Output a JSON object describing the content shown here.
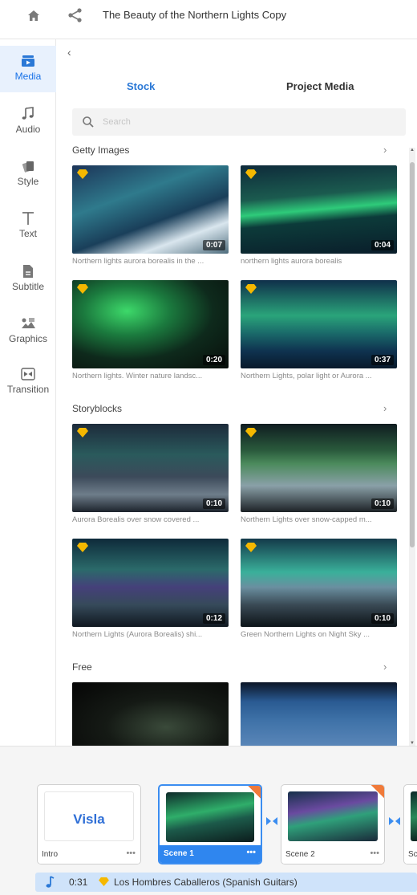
{
  "header": {
    "title": "The Beauty of the Northern Lights Copy"
  },
  "sidebar": {
    "items": [
      {
        "label": "Media",
        "icon": "media-icon",
        "active": true
      },
      {
        "label": "Audio",
        "icon": "music-note-icon"
      },
      {
        "label": "Style",
        "icon": "style-icon"
      },
      {
        "label": "Text",
        "icon": "text-icon"
      },
      {
        "label": "Subtitle",
        "icon": "subtitle-icon"
      },
      {
        "label": "Graphics",
        "icon": "graphics-icon"
      },
      {
        "label": "Transition",
        "icon": "transition-icon"
      }
    ]
  },
  "panel": {
    "tabs": {
      "stock": "Stock",
      "project": "Project Media"
    },
    "search": {
      "placeholder": "Search",
      "value": ""
    },
    "sections": {
      "getty": {
        "title": "Getty Images",
        "items": [
          {
            "duration": "0:07",
            "caption": "Northern lights aurora borealis in the ..."
          },
          {
            "duration": "0:04",
            "caption": "northern lights aurora borealis"
          },
          {
            "duration": "0:20",
            "caption": "Northern lights. Winter nature landsc..."
          },
          {
            "duration": "0:37",
            "caption": "Northern Lights, polar light or Aurora ..."
          }
        ]
      },
      "storyblocks": {
        "title": "Storyblocks",
        "items": [
          {
            "duration": "0:10",
            "caption": "Aurora Borealis over snow covered ..."
          },
          {
            "duration": "0:10",
            "caption": "Northern Lights over snow-capped m..."
          },
          {
            "duration": "0:12",
            "caption": "Northern Lights (Aurora Borealis) shi..."
          },
          {
            "duration": "0:10",
            "caption": "Green Northern Lights on Night Sky ..."
          }
        ]
      },
      "free": {
        "title": "Free"
      }
    }
  },
  "timeline": {
    "scenes": [
      {
        "name": "Intro",
        "logo": "Visla",
        "more": "•••"
      },
      {
        "name": "Scene 1",
        "more": "•••",
        "active": true
      },
      {
        "name": "Scene 2",
        "more": "•••"
      },
      {
        "name": "Sc"
      }
    ],
    "music": {
      "time": "0:31",
      "title": "Los Hombres Caballeros (Spanish Guitars)"
    }
  },
  "colors": {
    "accent": "#2a78d6",
    "premium_gem": "#f5b800",
    "active_scene": "#2f86ef",
    "music_bar": "#cfe3fa"
  }
}
